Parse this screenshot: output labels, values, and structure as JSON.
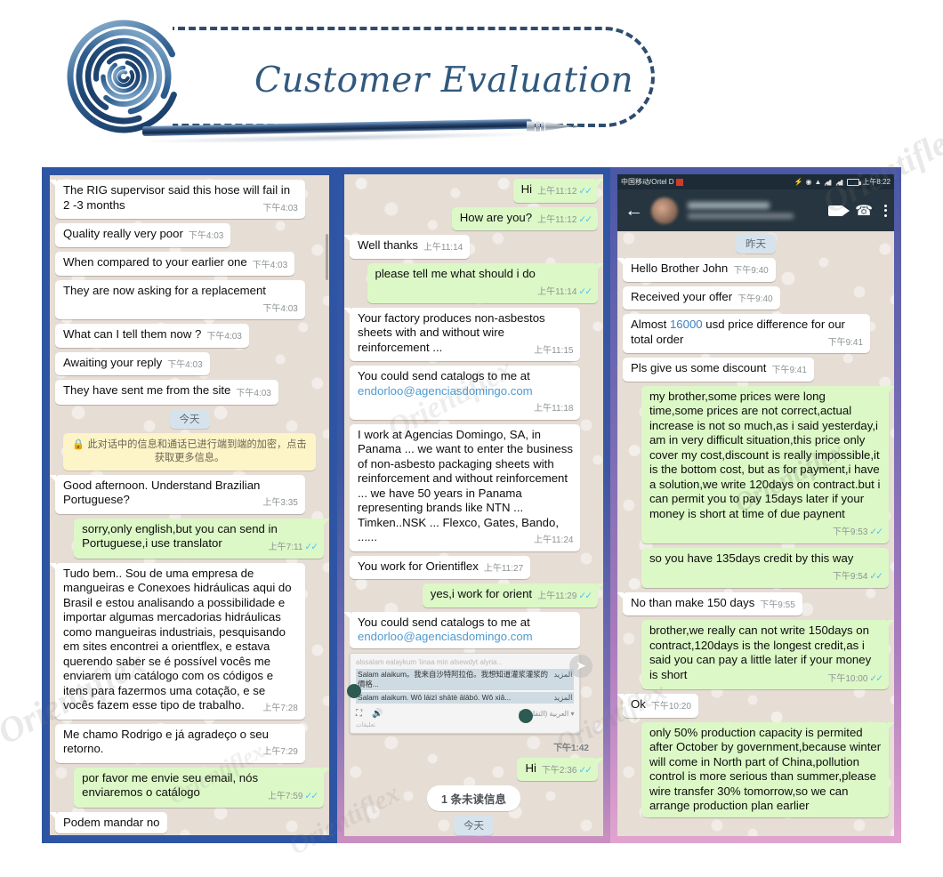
{
  "banner": {
    "title": "Customer Evaluation",
    "spiral_icon": "spiral-icon",
    "pen_icon": "pen-icon"
  },
  "watermarks": [
    "Orientiflex",
    "Orientiflex",
    "Orientiflex",
    "Orientiflex",
    "Orientiflex",
    "Orientiflex",
    "Orientiflex"
  ],
  "panels": [
    {
      "id": "chat-panel-1",
      "messages": [
        {
          "type": "in",
          "text": "The RIG supervisor said this hose will fail in 2 -3 months",
          "time": "下午4:03",
          "wrap": true
        },
        {
          "type": "in",
          "text": "Quality really very poor",
          "time": "下午4:03",
          "wrap": false
        },
        {
          "type": "in",
          "text": "When compared to your earlier one",
          "time": "下午4:03",
          "wrap": true
        },
        {
          "type": "in",
          "text": "They are now asking for a replacement",
          "time": "下午4:03",
          "wrap": true
        },
        {
          "type": "in",
          "text": "What can I tell them now ?",
          "time": "下午4:03",
          "wrap": false
        },
        {
          "type": "in",
          "text": "Awaiting your reply",
          "time": "下午4:03",
          "wrap": false
        },
        {
          "type": "in",
          "text": "They have sent me from the site",
          "time": "下午4:03",
          "wrap": true
        },
        {
          "type": "day",
          "text": "今天"
        },
        {
          "type": "encryption",
          "text": "此对话中的信息和通话已进行端到端的加密，点击获取更多信息。",
          "lock_icon": "lock-icon"
        },
        {
          "type": "in",
          "text": "Good afternoon. Understand Brazilian Portuguese?",
          "time": "上午3:35",
          "wrap": true
        },
        {
          "type": "out",
          "text": "sorry,only english,but you can send in Portuguese,i use translator",
          "time": "上午7:11",
          "ticks": true,
          "wrap": true
        },
        {
          "type": "in",
          "text": "Tudo bem.. Sou de uma empresa de mangueiras e Conexoes hidráulicas aqui do Brasil e estou analisando a possibilidade e importar algumas mercadorias hidráulicas como mangueiras industriais, pesquisando em sites encontrei a orientflex, e estava querendo saber se é possível vocês me enviarem um catálogo com os códigos e itens para fazermos uma cotação, e se vocês fazem esse tipo de trabalho.",
          "time": "上午7:28",
          "wrap": true
        },
        {
          "type": "in",
          "text": "Me chamo Rodrigo e já agradeço o seu retorno.",
          "time": "上午7:29",
          "wrap": true
        },
        {
          "type": "out",
          "text": "por favor me envie seu email, nós enviaremos o catálogo",
          "time": "上午7:59",
          "ticks": true,
          "wrap": true
        },
        {
          "type": "in",
          "text": "Podem mandar no",
          "time": "",
          "wrap": false
        }
      ]
    },
    {
      "id": "chat-panel-2",
      "messages": [
        {
          "type": "out",
          "text": "Hi",
          "time": "上午11:12",
          "ticks": true,
          "wrap": false
        },
        {
          "type": "out",
          "text": "How are you?",
          "time": "上午11:12",
          "ticks": true,
          "wrap": false
        },
        {
          "type": "in",
          "text": "Well thanks",
          "time": "上午11:14",
          "wrap": false
        },
        {
          "type": "out",
          "text": "please tell me what should i do",
          "time": "上午11:14",
          "ticks": true,
          "wrap": true
        },
        {
          "type": "in",
          "text": "Your factory produces non-asbestos sheets with and without wire reinforcement ...",
          "time": "上午11:15",
          "wrap": true
        },
        {
          "type": "in_link",
          "text": "You could send catalogs to me at ",
          "link": "endorloo@agenciasdomingo.com",
          "time": "上午11:18",
          "wrap": true
        },
        {
          "type": "in",
          "text": "I work at Agencias Domingo, SA, in Panama ... we want to enter the business of non-asbesto packaging sheets with reinforcement and without reinforcement ... we have 50 years in Panama representing brands like NTN ... Timken..NSK ... Flexco, Gates, Bando, ......",
          "time": "上午11:24",
          "wrap": true
        },
        {
          "type": "in",
          "text": "You work for Orientiflex",
          "time": "上午11:27",
          "wrap": false
        },
        {
          "type": "out",
          "text": "yes,i work for orient",
          "time": "上午11:29",
          "ticks": true,
          "wrap": false
        },
        {
          "type": "in_link",
          "text": "You could send catalogs to me at ",
          "link": "endorloo@agenciasdomingo.com",
          "time": "",
          "wrap": true
        }
      ],
      "translator_card": {
        "faded_line": "alssalam ealaykum  'iinaa min alsewdyt alyria...",
        "line1": "Salam alaikum。我来自沙特阿拉伯。我想知道灌浆灌浆的價格...",
        "line1_more": "المزيد",
        "line2": "Salam alaikum. Wǒ láizì shātè ālābó. Wǒ xiǎ...",
        "line2_more": "المزيد",
        "lang": "العربية (التقليدية)",
        "footer": "تعليقات",
        "time": "下午1:42",
        "expand_icon": "expand-icon",
        "speaker_icon": "speaker-icon",
        "share_icon": "share-icon"
      },
      "after_card": [
        {
          "type": "out",
          "text": "Hi",
          "time": "下午2:36",
          "ticks": true,
          "wrap": false
        },
        {
          "type": "unread",
          "text": "1 条未读信息"
        },
        {
          "type": "day",
          "text": "今天"
        }
      ]
    },
    {
      "id": "chat-panel-3",
      "status_bar": {
        "carrier": "中国移动/Ortel D",
        "time": "上午8:22",
        "icons": [
          "bluetooth-icon",
          "eye-icon",
          "wifi-icon",
          "signal-icon",
          "signal-icon",
          "battery-icon"
        ]
      },
      "chat_header": {
        "back_icon": "back-arrow-icon",
        "avatar": "avatar-blurred",
        "contact_name": "",
        "contact_status": "",
        "video_icon": "video-call-icon",
        "phone_icon": "voice-call-icon",
        "menu_icon": "overflow-menu-icon"
      },
      "messages": [
        {
          "type": "day",
          "text": "昨天"
        },
        {
          "type": "in",
          "text": "Hello Brother John",
          "time": "下午9:40",
          "wrap": false
        },
        {
          "type": "in",
          "text": "Received your offer",
          "time": "下午9:40",
          "wrap": false
        },
        {
          "type": "in_highlight",
          "pre": "Almost ",
          "highlight": "16000",
          "post": " usd price difference for our total order",
          "time": "下午9:41",
          "wrap": true
        },
        {
          "type": "in",
          "text": "Pls give us some discount",
          "time": "下午9:41",
          "wrap": false
        },
        {
          "type": "out",
          "text": "my brother,some prices were long time,some prices are not correct,actual increase is not so much,as i said yesterday,i am in very difficult situation,this price only cover my cost,discount is really impossible,it is the bottom cost, but as for payment,i have a solution,we write 120days on contract.but i can permit you to pay 15days later if your money is short at time of due paynent",
          "time": "下午9:53",
          "ticks": true,
          "wrap": true
        },
        {
          "type": "out",
          "text": "so you have 135days credit by this way",
          "time": "下午9:54",
          "ticks": true,
          "wrap": true
        },
        {
          "type": "in",
          "text": "No than make 150 days",
          "time": "下午9:55",
          "wrap": false
        },
        {
          "type": "out",
          "text": "brother,we really can not write 150days on contract,120days is the longest credit,as i said you can pay a little later if your money is short",
          "time": "下午10:00",
          "ticks": true,
          "wrap": true
        },
        {
          "type": "in",
          "text": "Ok",
          "time": "下午10:20",
          "wrap": false
        },
        {
          "type": "out",
          "text": "only 50% production capacity is permited after October by government,because winter will come in North part of China,pollution control is more serious than summer,please wire transfer 30% tomorrow,so we can arrange production plan earlier",
          "time": "",
          "wrap": true
        }
      ]
    }
  ],
  "colors": {
    "frame_blue": "#2e55a4",
    "frame_purple": "#7a6db4",
    "frame_pink": "#e0a3cf",
    "bubble_in": "#ffffff",
    "bubble_out": "#dcf8c6",
    "chat_bg": "#e6ddd4",
    "title_blue": "#31597e",
    "link_blue": "#4f9ad0",
    "tick_blue": "#4fc3f7"
  }
}
